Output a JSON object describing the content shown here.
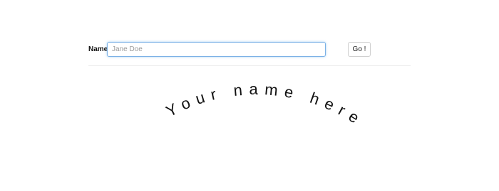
{
  "form": {
    "name_label": "Name",
    "name_input": {
      "value": "",
      "placeholder": "Jane Doe"
    },
    "go_button_label": "Go !"
  },
  "preview": {
    "curved_text": "Your name here"
  },
  "colors": {
    "input_focus_border": "#7cb1e6",
    "text": "#111111",
    "divider": "#eeeeee"
  }
}
